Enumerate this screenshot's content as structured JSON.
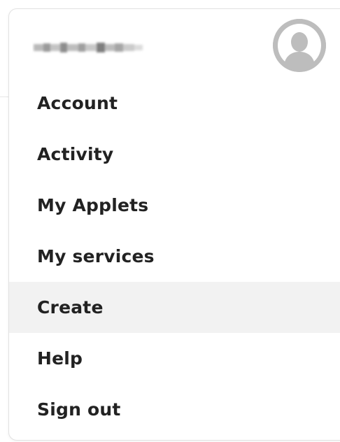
{
  "user": {
    "username": "",
    "avatar_icon": "user-avatar-placeholder-icon",
    "avatar_color": "#bdbdbd"
  },
  "menu": {
    "items": [
      {
        "label": "Account"
      },
      {
        "label": "Activity"
      },
      {
        "label": "My Applets"
      },
      {
        "label": "My services"
      },
      {
        "label": "Create",
        "highlighted": true
      },
      {
        "label": "Help"
      },
      {
        "label": "Sign out"
      }
    ],
    "highlight_color": "#f2f2f2",
    "text_color": "#222222"
  }
}
